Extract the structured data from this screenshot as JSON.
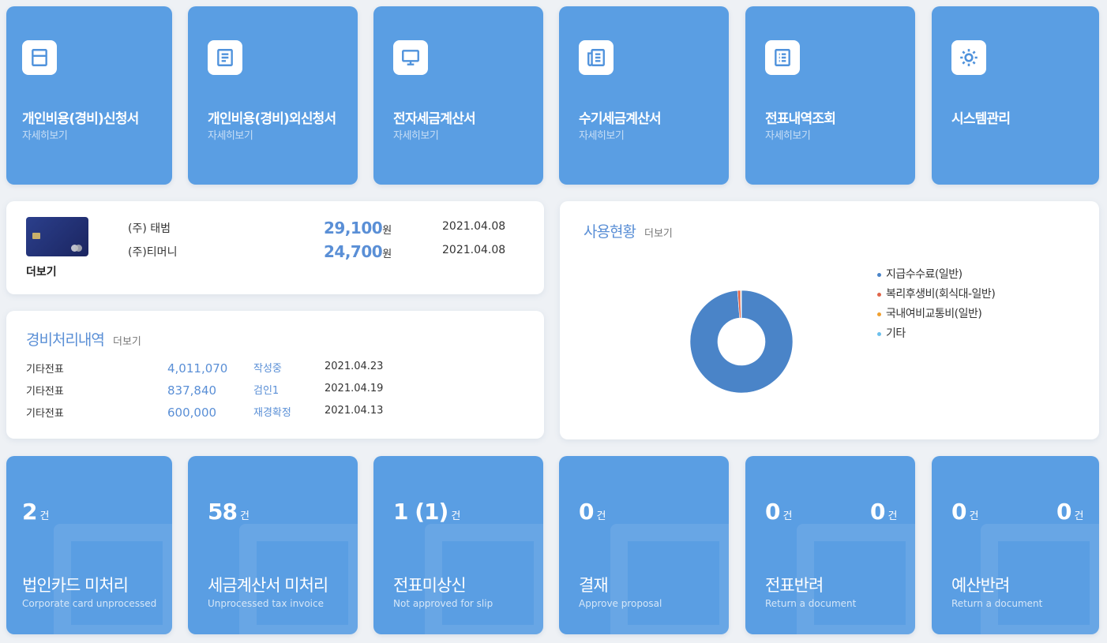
{
  "top_tiles": [
    {
      "title": "개인비용(경비)신청서",
      "sub": "자세히보기",
      "icon": "form-icon"
    },
    {
      "title": "개인비용(경비)외신청서",
      "sub": "자세히보기",
      "icon": "document-icon"
    },
    {
      "title": "전자세금계산서",
      "sub": "자세히보기",
      "icon": "monitor-icon"
    },
    {
      "title": "수기세금계산서",
      "sub": "자세히보기",
      "icon": "newspaper-icon"
    },
    {
      "title": "전표내역조회",
      "sub": "자세히보기",
      "icon": "list-icon"
    },
    {
      "title": "시스템관리",
      "sub": "",
      "icon": "gear-icon"
    }
  ],
  "card_panel": {
    "more": "더보기",
    "rows": [
      {
        "name": "(주) 태범",
        "amount": "29,100",
        "unit": "원",
        "date": "2021.04.08"
      },
      {
        "name": "(주)티머니",
        "amount": "24,700",
        "unit": "원",
        "date": "2021.04.08"
      }
    ]
  },
  "expense_panel": {
    "title": "경비처리내역",
    "more": "더보기",
    "rows": [
      {
        "type": "기타전표",
        "amount": "4,011,070",
        "status": "작성중",
        "date": "2021.04.23"
      },
      {
        "type": "기타전표",
        "amount": "837,840",
        "status": "검인1",
        "date": "2021.04.19"
      },
      {
        "type": "기타전표",
        "amount": "600,000",
        "status": "재경확정",
        "date": "2021.04.13"
      }
    ]
  },
  "usage_panel": {
    "title": "사용현황",
    "more": "더보기"
  },
  "chart_data": {
    "type": "pie",
    "donut": true,
    "categories": [
      "지급수수료(일반)",
      "복리후생비(회식대-일반)",
      "국내여비교통비(일반)",
      "기타"
    ],
    "values": [
      98.8,
      0.9,
      0.2,
      0.1
    ],
    "colors": [
      "#4a84c8",
      "#e0654a",
      "#f0a030",
      "#6cc0ec"
    ],
    "legend_position": "right"
  },
  "bottom_tiles": [
    {
      "count": "2",
      "unit": "건",
      "title": "법인카드 미처리",
      "sub": "Corporate card unprocessed"
    },
    {
      "count": "58",
      "unit": "건",
      "title": "세금계산서 미처리",
      "sub": "Unprocessed tax invoice"
    },
    {
      "count": "1 (1)",
      "unit": "건",
      "title": "전표미상신",
      "sub": "Not approved for slip"
    },
    {
      "count": "0",
      "unit": "건",
      "title": "결재",
      "sub": "Approve proposal"
    },
    {
      "count": "0",
      "unit": "건",
      "count2": "0",
      "unit2": "건",
      "title": "전표반려",
      "sub": "Return a document"
    },
    {
      "count": "0",
      "unit": "건",
      "count2": "0",
      "unit2": "건",
      "title": "예산반려",
      "sub": "Return a document"
    }
  ]
}
